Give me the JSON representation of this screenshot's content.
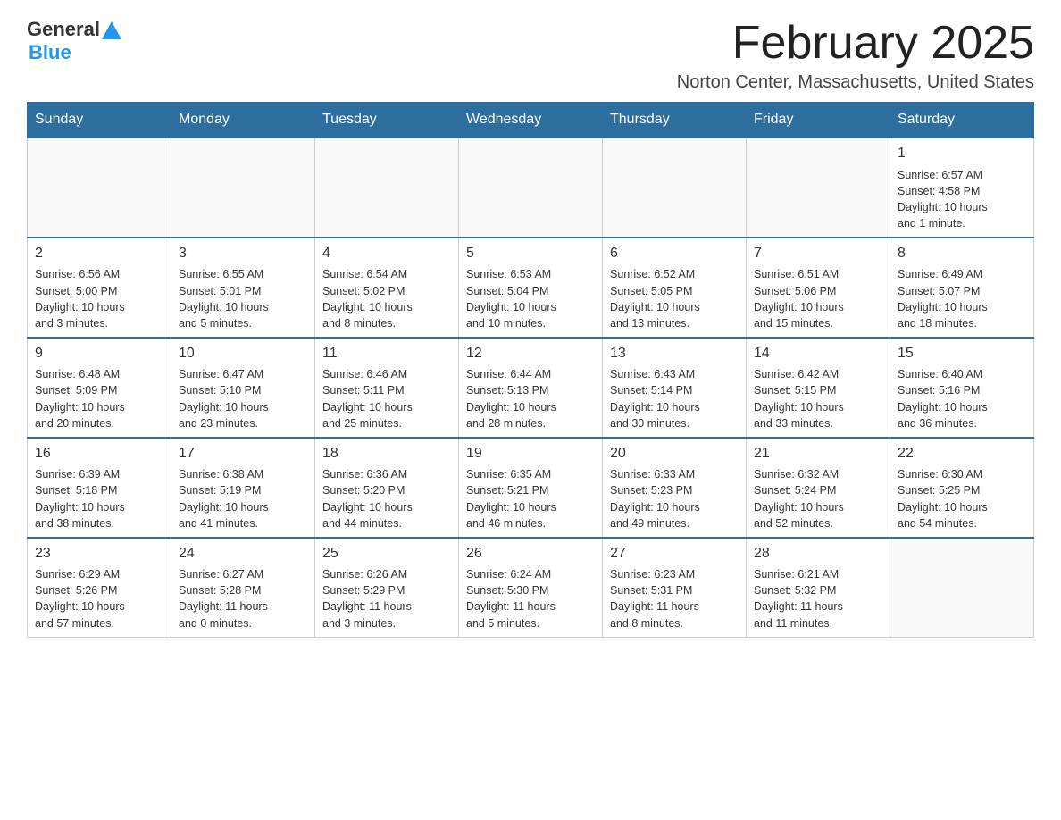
{
  "header": {
    "logo_general": "General",
    "logo_blue": "Blue",
    "month_title": "February 2025",
    "location": "Norton Center, Massachusetts, United States"
  },
  "days_of_week": [
    "Sunday",
    "Monday",
    "Tuesday",
    "Wednesday",
    "Thursday",
    "Friday",
    "Saturday"
  ],
  "weeks": [
    [
      {
        "day": "",
        "info": ""
      },
      {
        "day": "",
        "info": ""
      },
      {
        "day": "",
        "info": ""
      },
      {
        "day": "",
        "info": ""
      },
      {
        "day": "",
        "info": ""
      },
      {
        "day": "",
        "info": ""
      },
      {
        "day": "1",
        "info": "Sunrise: 6:57 AM\nSunset: 4:58 PM\nDaylight: 10 hours\nand 1 minute."
      }
    ],
    [
      {
        "day": "2",
        "info": "Sunrise: 6:56 AM\nSunset: 5:00 PM\nDaylight: 10 hours\nand 3 minutes."
      },
      {
        "day": "3",
        "info": "Sunrise: 6:55 AM\nSunset: 5:01 PM\nDaylight: 10 hours\nand 5 minutes."
      },
      {
        "day": "4",
        "info": "Sunrise: 6:54 AM\nSunset: 5:02 PM\nDaylight: 10 hours\nand 8 minutes."
      },
      {
        "day": "5",
        "info": "Sunrise: 6:53 AM\nSunset: 5:04 PM\nDaylight: 10 hours\nand 10 minutes."
      },
      {
        "day": "6",
        "info": "Sunrise: 6:52 AM\nSunset: 5:05 PM\nDaylight: 10 hours\nand 13 minutes."
      },
      {
        "day": "7",
        "info": "Sunrise: 6:51 AM\nSunset: 5:06 PM\nDaylight: 10 hours\nand 15 minutes."
      },
      {
        "day": "8",
        "info": "Sunrise: 6:49 AM\nSunset: 5:07 PM\nDaylight: 10 hours\nand 18 minutes."
      }
    ],
    [
      {
        "day": "9",
        "info": "Sunrise: 6:48 AM\nSunset: 5:09 PM\nDaylight: 10 hours\nand 20 minutes."
      },
      {
        "day": "10",
        "info": "Sunrise: 6:47 AM\nSunset: 5:10 PM\nDaylight: 10 hours\nand 23 minutes."
      },
      {
        "day": "11",
        "info": "Sunrise: 6:46 AM\nSunset: 5:11 PM\nDaylight: 10 hours\nand 25 minutes."
      },
      {
        "day": "12",
        "info": "Sunrise: 6:44 AM\nSunset: 5:13 PM\nDaylight: 10 hours\nand 28 minutes."
      },
      {
        "day": "13",
        "info": "Sunrise: 6:43 AM\nSunset: 5:14 PM\nDaylight: 10 hours\nand 30 minutes."
      },
      {
        "day": "14",
        "info": "Sunrise: 6:42 AM\nSunset: 5:15 PM\nDaylight: 10 hours\nand 33 minutes."
      },
      {
        "day": "15",
        "info": "Sunrise: 6:40 AM\nSunset: 5:16 PM\nDaylight: 10 hours\nand 36 minutes."
      }
    ],
    [
      {
        "day": "16",
        "info": "Sunrise: 6:39 AM\nSunset: 5:18 PM\nDaylight: 10 hours\nand 38 minutes."
      },
      {
        "day": "17",
        "info": "Sunrise: 6:38 AM\nSunset: 5:19 PM\nDaylight: 10 hours\nand 41 minutes."
      },
      {
        "day": "18",
        "info": "Sunrise: 6:36 AM\nSunset: 5:20 PM\nDaylight: 10 hours\nand 44 minutes."
      },
      {
        "day": "19",
        "info": "Sunrise: 6:35 AM\nSunset: 5:21 PM\nDaylight: 10 hours\nand 46 minutes."
      },
      {
        "day": "20",
        "info": "Sunrise: 6:33 AM\nSunset: 5:23 PM\nDaylight: 10 hours\nand 49 minutes."
      },
      {
        "day": "21",
        "info": "Sunrise: 6:32 AM\nSunset: 5:24 PM\nDaylight: 10 hours\nand 52 minutes."
      },
      {
        "day": "22",
        "info": "Sunrise: 6:30 AM\nSunset: 5:25 PM\nDaylight: 10 hours\nand 54 minutes."
      }
    ],
    [
      {
        "day": "23",
        "info": "Sunrise: 6:29 AM\nSunset: 5:26 PM\nDaylight: 10 hours\nand 57 minutes."
      },
      {
        "day": "24",
        "info": "Sunrise: 6:27 AM\nSunset: 5:28 PM\nDaylight: 11 hours\nand 0 minutes."
      },
      {
        "day": "25",
        "info": "Sunrise: 6:26 AM\nSunset: 5:29 PM\nDaylight: 11 hours\nand 3 minutes."
      },
      {
        "day": "26",
        "info": "Sunrise: 6:24 AM\nSunset: 5:30 PM\nDaylight: 11 hours\nand 5 minutes."
      },
      {
        "day": "27",
        "info": "Sunrise: 6:23 AM\nSunset: 5:31 PM\nDaylight: 11 hours\nand 8 minutes."
      },
      {
        "day": "28",
        "info": "Sunrise: 6:21 AM\nSunset: 5:32 PM\nDaylight: 11 hours\nand 11 minutes."
      },
      {
        "day": "",
        "info": ""
      }
    ]
  ]
}
